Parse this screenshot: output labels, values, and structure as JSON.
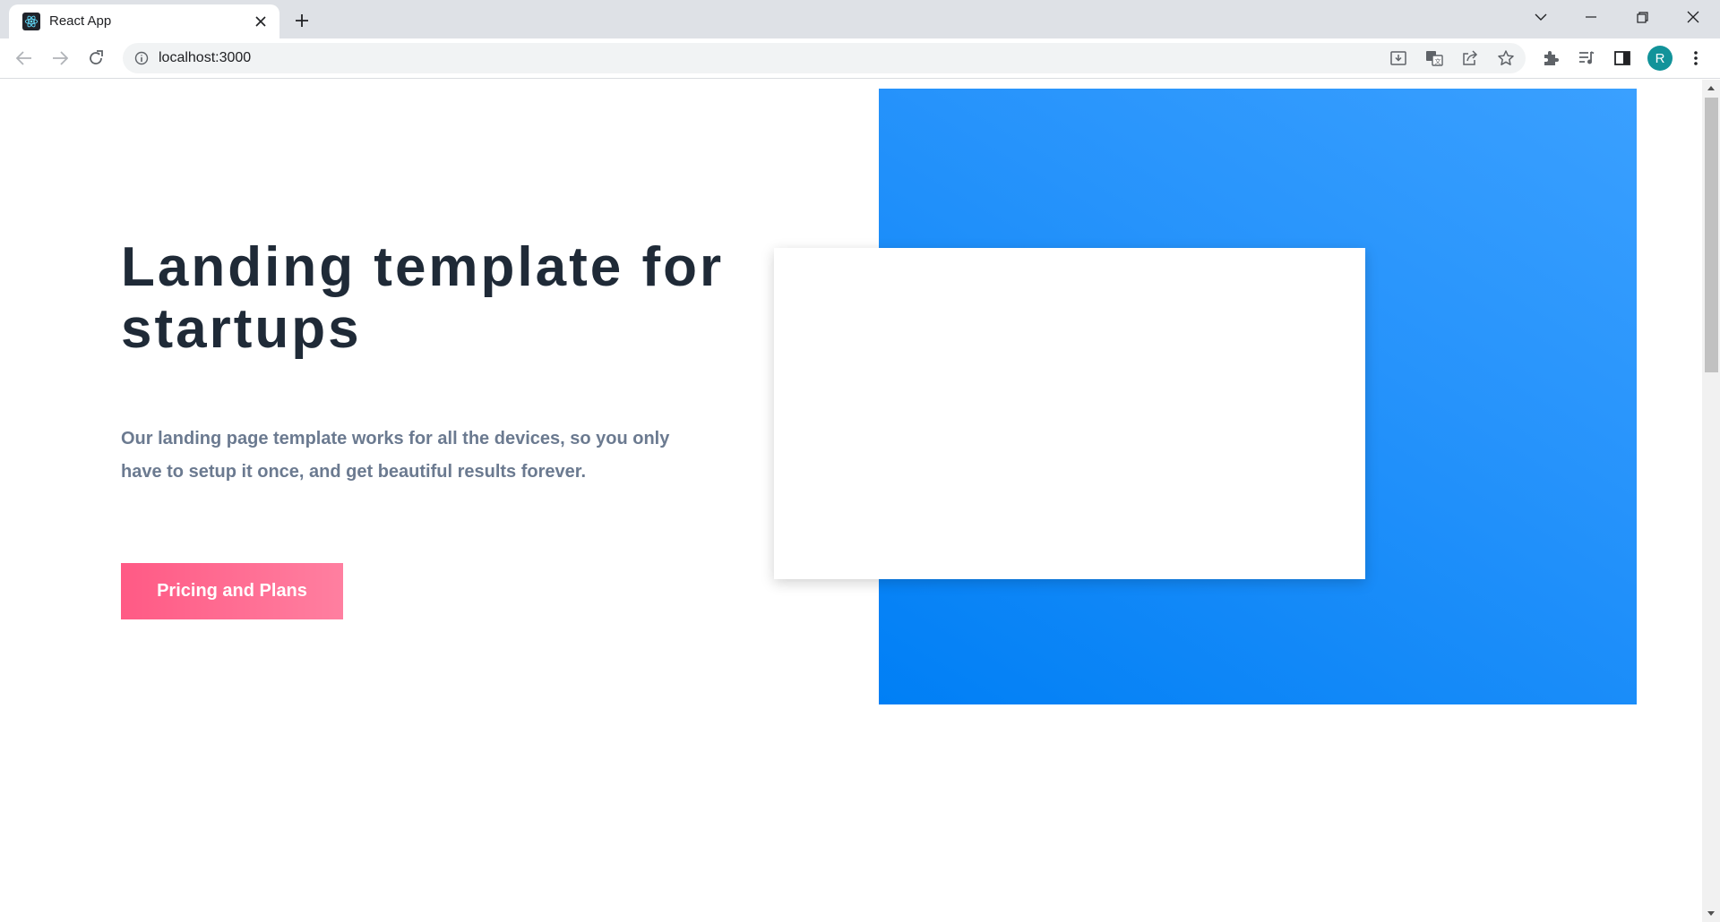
{
  "browser": {
    "tab": {
      "title": "React App",
      "favicon": "react-logo-icon"
    },
    "address": {
      "url": "localhost:3000"
    },
    "profile": {
      "initial": "R",
      "color": "#12939a"
    }
  },
  "hero": {
    "title": "Landing template for startups",
    "subtitle": "Our landing page template works for all the devices, so you only have to setup it once, and get beautiful results forever.",
    "cta_label": "Pricing and Plans"
  },
  "colors": {
    "title": "#1f2a37",
    "subtitle": "#6b7a90",
    "cta_start": "#ff5a85",
    "cta_end": "#ff7fa0",
    "panel_light": "#3aa0ff",
    "panel_dark": "#007ff5"
  }
}
